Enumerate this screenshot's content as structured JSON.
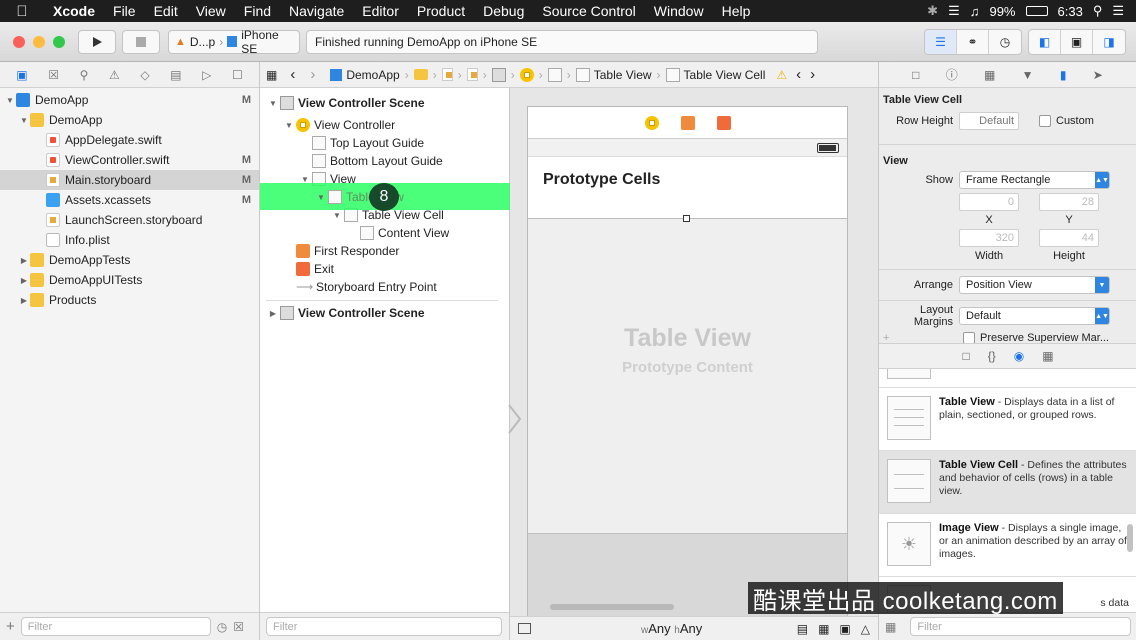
{
  "menubar": {
    "app_name": "Xcode",
    "items": [
      "File",
      "Edit",
      "View",
      "Find",
      "Navigate",
      "Editor",
      "Product",
      "Debug",
      "Source Control",
      "Window",
      "Help"
    ],
    "battery": "99%",
    "time": "6:33"
  },
  "toolbar": {
    "scheme": "D...p",
    "device": "iPhone SE",
    "status": "Finished running DemoApp on iPhone SE"
  },
  "navigator": {
    "items": [
      {
        "label": "DemoApp",
        "badge": "M"
      },
      {
        "label": "DemoApp",
        "badge": ""
      },
      {
        "label": "AppDelegate.swift",
        "badge": ""
      },
      {
        "label": "ViewController.swift",
        "badge": "M"
      },
      {
        "label": "Main.storyboard",
        "badge": "M"
      },
      {
        "label": "Assets.xcassets",
        "badge": "M"
      },
      {
        "label": "LaunchScreen.storyboard",
        "badge": ""
      },
      {
        "label": "Info.plist",
        "badge": ""
      },
      {
        "label": "DemoAppTests",
        "badge": ""
      },
      {
        "label": "DemoAppUITests",
        "badge": ""
      },
      {
        "label": "Products",
        "badge": ""
      }
    ],
    "filter_placeholder": "Filter"
  },
  "jumpbar": {
    "project": "DemoApp",
    "table_view": "Table View",
    "table_view_cell": "Table View Cell"
  },
  "outline": {
    "rows": [
      {
        "label": "View Controller Scene"
      },
      {
        "label": "View Controller"
      },
      {
        "label": "Top Layout Guide"
      },
      {
        "label": "Bottom Layout Guide"
      },
      {
        "label": "View"
      },
      {
        "label": "Table View"
      },
      {
        "label": "Table View Cell"
      },
      {
        "label": "Content View"
      },
      {
        "label": "First Responder"
      },
      {
        "label": "Exit"
      },
      {
        "label": "Storyboard Entry Point"
      },
      {
        "label": "View Controller Scene"
      }
    ],
    "filter_placeholder": "Filter"
  },
  "canvas": {
    "prototype_header": "Prototype Cells",
    "table_view_title": "Table View",
    "table_view_subtitle": "Prototype Content",
    "size_w_prefix": "w",
    "size_w": "Any",
    "size_h_prefix": "h",
    "size_h": "Any"
  },
  "inspector": {
    "table_view_cell_title": "Table View Cell",
    "row_height_label": "Row Height",
    "row_height_placeholder": "Default",
    "custom_label": "Custom",
    "view_title": "View",
    "show_label": "Show",
    "show_value": "Frame Rectangle",
    "x_value": "0",
    "y_value": "28",
    "x_label": "X",
    "y_label": "Y",
    "width_value": "320",
    "height_value": "44",
    "width_label": "Width",
    "height_label": "Height",
    "arrange_label": "Arrange",
    "arrange_value": "Position View",
    "layout_margins_label": "Layout Margins",
    "layout_margins_value": "Default",
    "preserve_label": "Preserve Superview Mar..."
  },
  "library": {
    "items": [
      {
        "title": "Table View",
        "desc": " - Displays data in a list of plain, sectioned, or grouped rows."
      },
      {
        "title": "Table View Cell",
        "desc": " - Defines the attributes and behavior of cells (rows) in a table view."
      },
      {
        "title": "Image View",
        "desc": " - Displays a single image, or an animation described by an array of images."
      },
      {
        "title": "",
        "desc": "s data"
      }
    ],
    "filter_placeholder": "Filter"
  },
  "overlay": {
    "step": "8",
    "watermark": "酷课堂出品 coolketang.com"
  },
  "colors": {
    "accent": "#2f86e0",
    "highlight": "#2dff64",
    "folder": "#f5c542"
  }
}
